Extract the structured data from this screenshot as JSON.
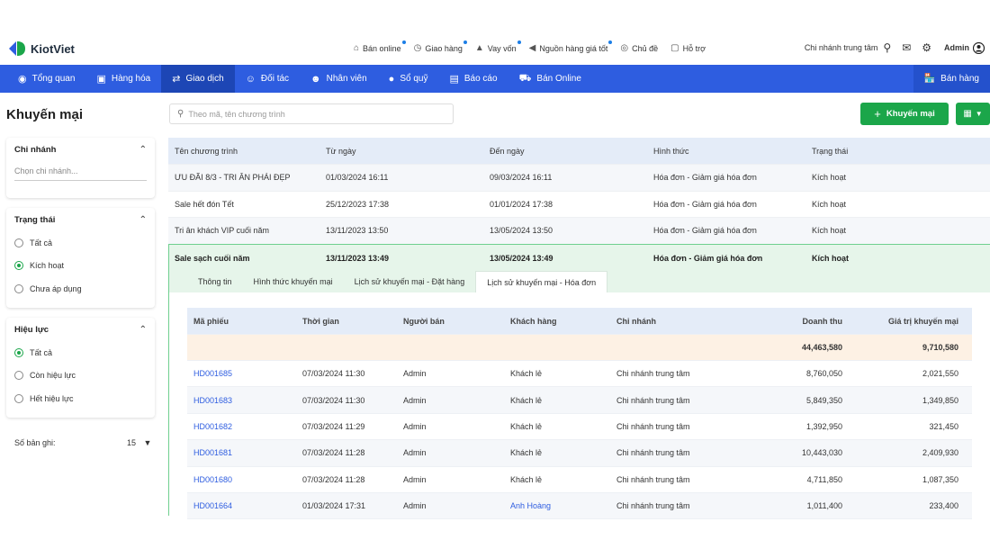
{
  "app": {
    "logo_text": "KiotViet"
  },
  "topbar": {
    "links": [
      {
        "icon": "shop-icon",
        "label": "Bán online",
        "dot": true
      },
      {
        "icon": "delivery-icon",
        "label": "Giao hàng",
        "dot": true
      },
      {
        "icon": "money-bag-icon",
        "label": "Vay vốn",
        "dot": true
      },
      {
        "icon": "supply-icon",
        "label": "Nguồn hàng giá tốt",
        "dot": true
      },
      {
        "icon": "palette-icon",
        "label": "Chủ đề",
        "dot": false
      },
      {
        "icon": "chat-icon",
        "label": "Hỗ trợ",
        "dot": false
      }
    ],
    "branch": "Chi nhánh trung tâm",
    "admin": "Admin"
  },
  "nav": {
    "items": [
      {
        "icon": "eye-icon",
        "label": "Tổng quan",
        "active": false
      },
      {
        "icon": "box-icon",
        "label": "Hàng hóa",
        "active": false
      },
      {
        "icon": "exchange-icon",
        "label": "Giao dịch",
        "active": true
      },
      {
        "icon": "partner-icon",
        "label": "Đối tác",
        "active": false
      },
      {
        "icon": "staff-icon",
        "label": "Nhân viên",
        "active": false
      },
      {
        "icon": "cashbook-icon",
        "label": "Sổ quỹ",
        "active": false
      },
      {
        "icon": "report-icon",
        "label": "Báo cáo",
        "active": false
      },
      {
        "icon": "cart-icon",
        "label": "Bán Online",
        "active": false
      }
    ],
    "sell_label": "Bán hàng"
  },
  "page": {
    "title": "Khuyến mại"
  },
  "filters": {
    "branch": {
      "title": "Chi nhánh",
      "placeholder": "Chọn chi nhánh..."
    },
    "status": {
      "title": "Trạng thái",
      "options": [
        "Tất cả",
        "Kích hoạt",
        "Chưa áp dụng"
      ],
      "selected": 1
    },
    "validity": {
      "title": "Hiệu lực",
      "options": [
        "Tất cả",
        "Còn hiệu lực",
        "Hết hiệu lực"
      ],
      "selected": 0
    },
    "records_label": "Số bản ghi:",
    "records_value": "15"
  },
  "search": {
    "placeholder": "Theo mã, tên chương trình"
  },
  "buttons": {
    "add_promo": "Khuyến mại"
  },
  "table": {
    "headers": [
      "Tên chương trình",
      "Từ ngày",
      "Đến ngày",
      "Hình thức",
      "Trạng thái"
    ],
    "rows": [
      [
        "ƯU ĐÃI 8/3 - TRI ÂN PHÁI ĐẸP",
        "01/03/2024 16:11",
        "09/03/2024 16:11",
        "Hóa đơn - Giảm giá hóa đơn",
        "Kích hoạt"
      ],
      [
        "Sale hết đón Tết",
        "25/12/2023 17:38",
        "01/01/2024 17:38",
        "Hóa đơn - Giảm giá hóa đơn",
        "Kích hoạt"
      ],
      [
        "Tri ân khách VIP cuối năm",
        "13/11/2023 13:50",
        "13/05/2024 13:50",
        "Hóa đơn - Giảm giá hóa đơn",
        "Kích hoạt"
      ]
    ],
    "expanded_row": [
      "Sale sạch cuối năm",
      "13/11/2023 13:49",
      "13/05/2024 13:49",
      "Hóa đơn - Giảm giá hóa đơn",
      "Kích hoạt"
    ]
  },
  "detail": {
    "tabs": [
      "Thông tin",
      "Hình thức khuyến mại",
      "Lịch sử khuyến mại - Đặt hàng",
      "Lịch sử khuyến mại - Hóa đơn"
    ],
    "active_tab": 3,
    "headers": [
      "Mã phiếu",
      "Thời gian",
      "Người bán",
      "Khách hàng",
      "Chi nhánh",
      "Doanh thu",
      "Giá trị khuyến mại"
    ],
    "totals": {
      "revenue": "44,463,580",
      "promo": "9,710,580"
    },
    "rows": [
      [
        "HD001685",
        "07/03/2024 11:30",
        "Admin",
        "Khách lẻ",
        "Chi nhánh trung tâm",
        "8,760,050",
        "2,021,550"
      ],
      [
        "HD001683",
        "07/03/2024 11:30",
        "Admin",
        "Khách lẻ",
        "Chi nhánh trung tâm",
        "5,849,350",
        "1,349,850"
      ],
      [
        "HD001682",
        "07/03/2024 11:29",
        "Admin",
        "Khách lẻ",
        "Chi nhánh trung tâm",
        "1,392,950",
        "321,450"
      ],
      [
        "HD001681",
        "07/03/2024 11:28",
        "Admin",
        "Khách lẻ",
        "Chi nhánh trung tâm",
        "10,443,030",
        "2,409,930"
      ],
      [
        "HD001680",
        "07/03/2024 11:28",
        "Admin",
        "Khách lẻ",
        "Chi nhánh trung tâm",
        "4,711,850",
        "1,087,350"
      ],
      [
        "HD001664",
        "01/03/2024 17:31",
        "Admin",
        "Anh Hoàng",
        "Chi nhánh trung tâm",
        "1,011,400",
        "233,400"
      ]
    ]
  },
  "colors": {
    "primary": "#2e5de0",
    "green": "#1ba64a"
  }
}
